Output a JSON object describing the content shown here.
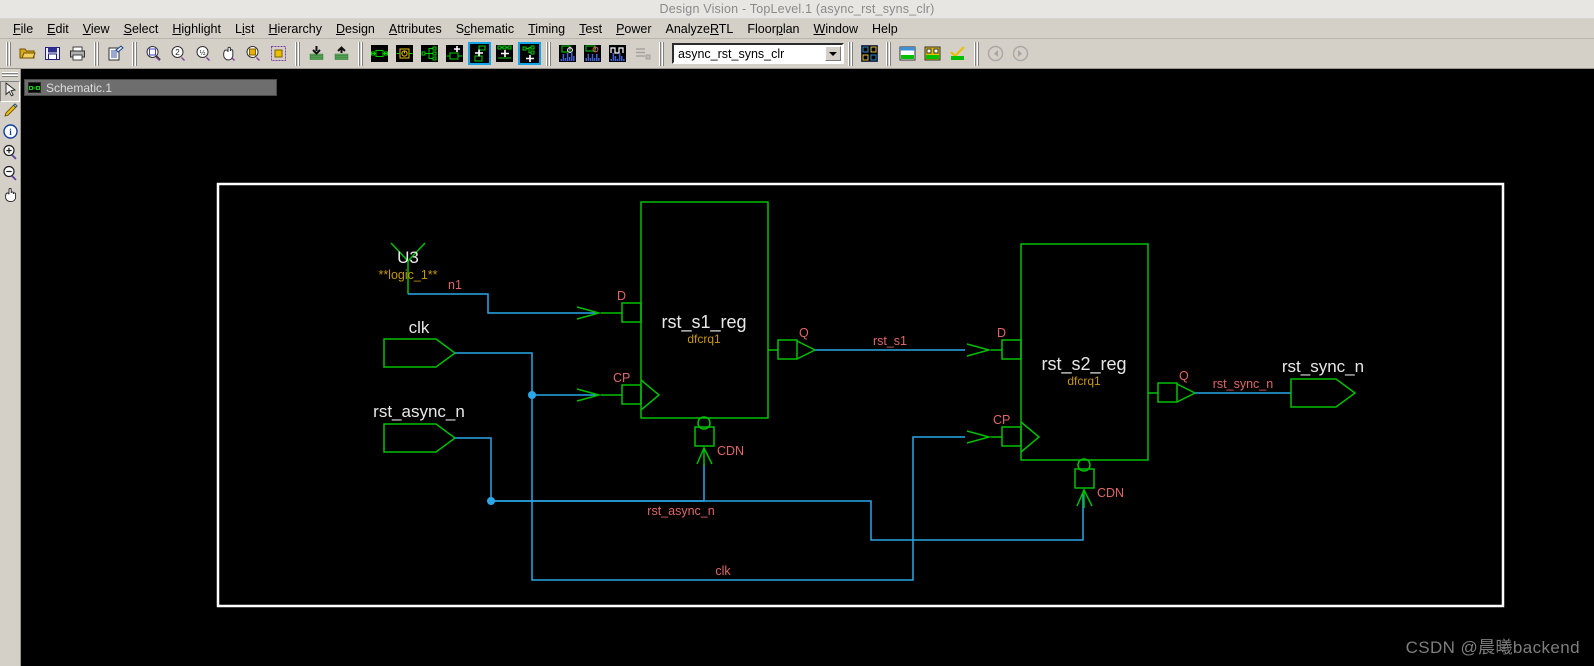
{
  "window": {
    "title": "Design Vision - TopLevel.1 (async_rst_syns_clr)"
  },
  "menubar": {
    "items": [
      {
        "label": "File",
        "mnemonic_index": 0
      },
      {
        "label": "Edit",
        "mnemonic_index": 0
      },
      {
        "label": "View",
        "mnemonic_index": 0
      },
      {
        "label": "Select",
        "mnemonic_index": 0
      },
      {
        "label": "Highlight",
        "mnemonic_index": 0
      },
      {
        "label": "List",
        "mnemonic_index": 1
      },
      {
        "label": "Hierarchy",
        "mnemonic_index": 0
      },
      {
        "label": "Design",
        "mnemonic_index": 0
      },
      {
        "label": "Attributes",
        "mnemonic_index": 0
      },
      {
        "label": "Schematic",
        "mnemonic_index": 1
      },
      {
        "label": "Timing",
        "mnemonic_index": 0
      },
      {
        "label": "Test",
        "mnemonic_index": 0
      },
      {
        "label": "Power",
        "mnemonic_index": 0
      },
      {
        "label": "AnalyzeRTL",
        "mnemonic_index": 7
      },
      {
        "label": "Floorplan",
        "mnemonic_index": 5
      },
      {
        "label": "Window",
        "mnemonic_index": 0
      },
      {
        "label": "Help",
        "mnemonic_index": 9
      }
    ]
  },
  "toolbar": {
    "groups": [
      {
        "buttons": [
          {
            "icon": "open-folder-icon",
            "name": "open-design-button",
            "selected": false
          },
          {
            "icon": "save-floppy-icon",
            "name": "save-design-button",
            "selected": false
          },
          {
            "icon": "printer-icon",
            "name": "print-button",
            "selected": false
          }
        ]
      },
      {
        "buttons": [
          {
            "icon": "edit-document-icon",
            "name": "edit-properties-button",
            "selected": false
          }
        ]
      },
      {
        "buttons": [
          {
            "icon": "zoom-fit-icon",
            "name": "zoom-fit-button",
            "selected": false
          },
          {
            "icon": "zoom-2x-icon",
            "name": "zoom-in-2x-button",
            "selected": false
          },
          {
            "icon": "zoom-half-icon",
            "name": "zoom-out-half-button",
            "selected": false
          },
          {
            "icon": "pan-hand-icon",
            "name": "pan-button",
            "selected": false
          },
          {
            "icon": "zoom-area-icon",
            "name": "zoom-area-button",
            "selected": false
          },
          {
            "icon": "zoom-selection-icon",
            "name": "zoom-selection-button",
            "selected": false
          }
        ]
      },
      {
        "buttons": [
          {
            "icon": "push-down-icon",
            "name": "push-down-hierarchy-button",
            "selected": false
          },
          {
            "icon": "pop-up-icon",
            "name": "pop-up-hierarchy-button",
            "selected": false
          }
        ]
      },
      {
        "buttons": [
          {
            "icon": "schematic-cell-icon",
            "name": "new-design-schematic-button",
            "selected": false
          },
          {
            "icon": "schematic-clock-icon",
            "name": "new-symbol-view-button",
            "selected": false
          },
          {
            "icon": "schematic-fanout-icon",
            "name": "new-path-schematic-button",
            "selected": false
          },
          {
            "icon": "schematic-plus-cell-icon",
            "name": "add-to-schematic-button",
            "selected": false
          },
          {
            "icon": "schematic-add-driver-icon",
            "name": "add-driver-button",
            "selected": true
          },
          {
            "icon": "schematic-add-net-icon",
            "name": "add-net-button",
            "selected": false
          },
          {
            "icon": "schematic-add-load-icon",
            "name": "add-load-button",
            "selected": true
          }
        ]
      },
      {
        "buttons": [
          {
            "icon": "histogram-clock-icon",
            "name": "clock-histogram-button",
            "selected": false
          },
          {
            "icon": "histogram-timing-icon",
            "name": "timing-histogram-button",
            "selected": false
          },
          {
            "icon": "waveform-icon",
            "name": "waveform-button",
            "selected": false
          },
          {
            "icon": "list-report-icon",
            "name": "report-button",
            "selected": false,
            "disabled": true
          }
        ]
      }
    ],
    "hierarchy_combo": {
      "value": "async_rst_syns_clr",
      "name": "hierarchy-combo"
    },
    "right_groups": [
      {
        "buttons": [
          {
            "icon": "layout-map-icon",
            "name": "design-map-button",
            "selected": false
          }
        ]
      },
      {
        "buttons": [
          {
            "icon": "window-split-icon",
            "name": "split-window-button",
            "selected": false
          },
          {
            "icon": "window-tile-icon",
            "name": "tile-window-button",
            "selected": false
          },
          {
            "icon": "check-mark-icon",
            "name": "check-design-button",
            "selected": false
          }
        ]
      },
      {
        "buttons": [
          {
            "icon": "back-arrow-icon",
            "name": "back-button",
            "selected": false,
            "disabled": true
          },
          {
            "icon": "forward-arrow-icon",
            "name": "forward-button",
            "selected": false,
            "disabled": true
          }
        ]
      }
    ]
  },
  "left_toolstrip": {
    "buttons": [
      {
        "icon": "cursor-arrow-icon",
        "name": "select-tool-button",
        "active": true
      },
      {
        "icon": "pencil-icon",
        "name": "annotate-tool-button",
        "active": false
      },
      {
        "icon": "info-icon",
        "name": "info-tool-button",
        "active": false
      },
      {
        "icon": "zoom-in-icon",
        "name": "zoom-in-tool-button",
        "active": false
      },
      {
        "icon": "zoom-out-icon",
        "name": "zoom-out-tool-button",
        "active": false
      },
      {
        "icon": "hand-pan-icon",
        "name": "pan-tool-button",
        "active": false
      }
    ]
  },
  "document_tab": {
    "icon": "schematic-view-icon",
    "label": "Schematic.1"
  },
  "watermark": {
    "text": "CSDN @晨曦backend"
  },
  "colors": {
    "canvas_bg": "#000000",
    "symbol_green": "#00c000",
    "wire_blue": "#29a7e8",
    "net_label_red": "#e06666",
    "instance_white": "#e8e8e8",
    "cell_type_gold": "#c8960a",
    "boundary_white": "#ffffff",
    "selection_cyan": "#14a5e8"
  },
  "schematic": {
    "boundary": {
      "name": "design-boundary-rect"
    },
    "ports": [
      {
        "name": "port-clk",
        "label": "clk",
        "direction": "input"
      },
      {
        "name": "port-rst-async-n",
        "label": "rst_async_n",
        "direction": "input"
      },
      {
        "name": "port-rst-sync-n",
        "label": "rst_sync_n",
        "direction": "output"
      }
    ],
    "tie_cell": {
      "name": "tie-high-U3",
      "instance": "U3",
      "cell_type": "**logic_1**"
    },
    "instances": [
      {
        "name": "instance-rst-s1-reg",
        "instance": "rst_s1_reg",
        "cell_type": "dfcrq1",
        "pins": [
          {
            "label": "D",
            "name": "pin-d"
          },
          {
            "label": "CP",
            "name": "pin-cp"
          },
          {
            "label": "Q",
            "name": "pin-q"
          },
          {
            "label": "CDN",
            "name": "pin-cdn"
          }
        ]
      },
      {
        "name": "instance-rst-s2-reg",
        "instance": "rst_s2_reg",
        "cell_type": "dfcrq1",
        "pins": [
          {
            "label": "D",
            "name": "pin-d"
          },
          {
            "label": "CP",
            "name": "pin-cp"
          },
          {
            "label": "Q",
            "name": "pin-q"
          },
          {
            "label": "CDN",
            "name": "pin-cdn"
          }
        ]
      }
    ],
    "nets": [
      {
        "name": "net-n1",
        "label": "n1"
      },
      {
        "name": "net-rst-s1",
        "label": "rst_s1"
      },
      {
        "name": "net-rst-sync-n",
        "label": "rst_sync_n"
      },
      {
        "name": "net-rst-async-n",
        "label": "rst_async_n"
      },
      {
        "name": "net-clk",
        "label": "clk"
      }
    ]
  }
}
